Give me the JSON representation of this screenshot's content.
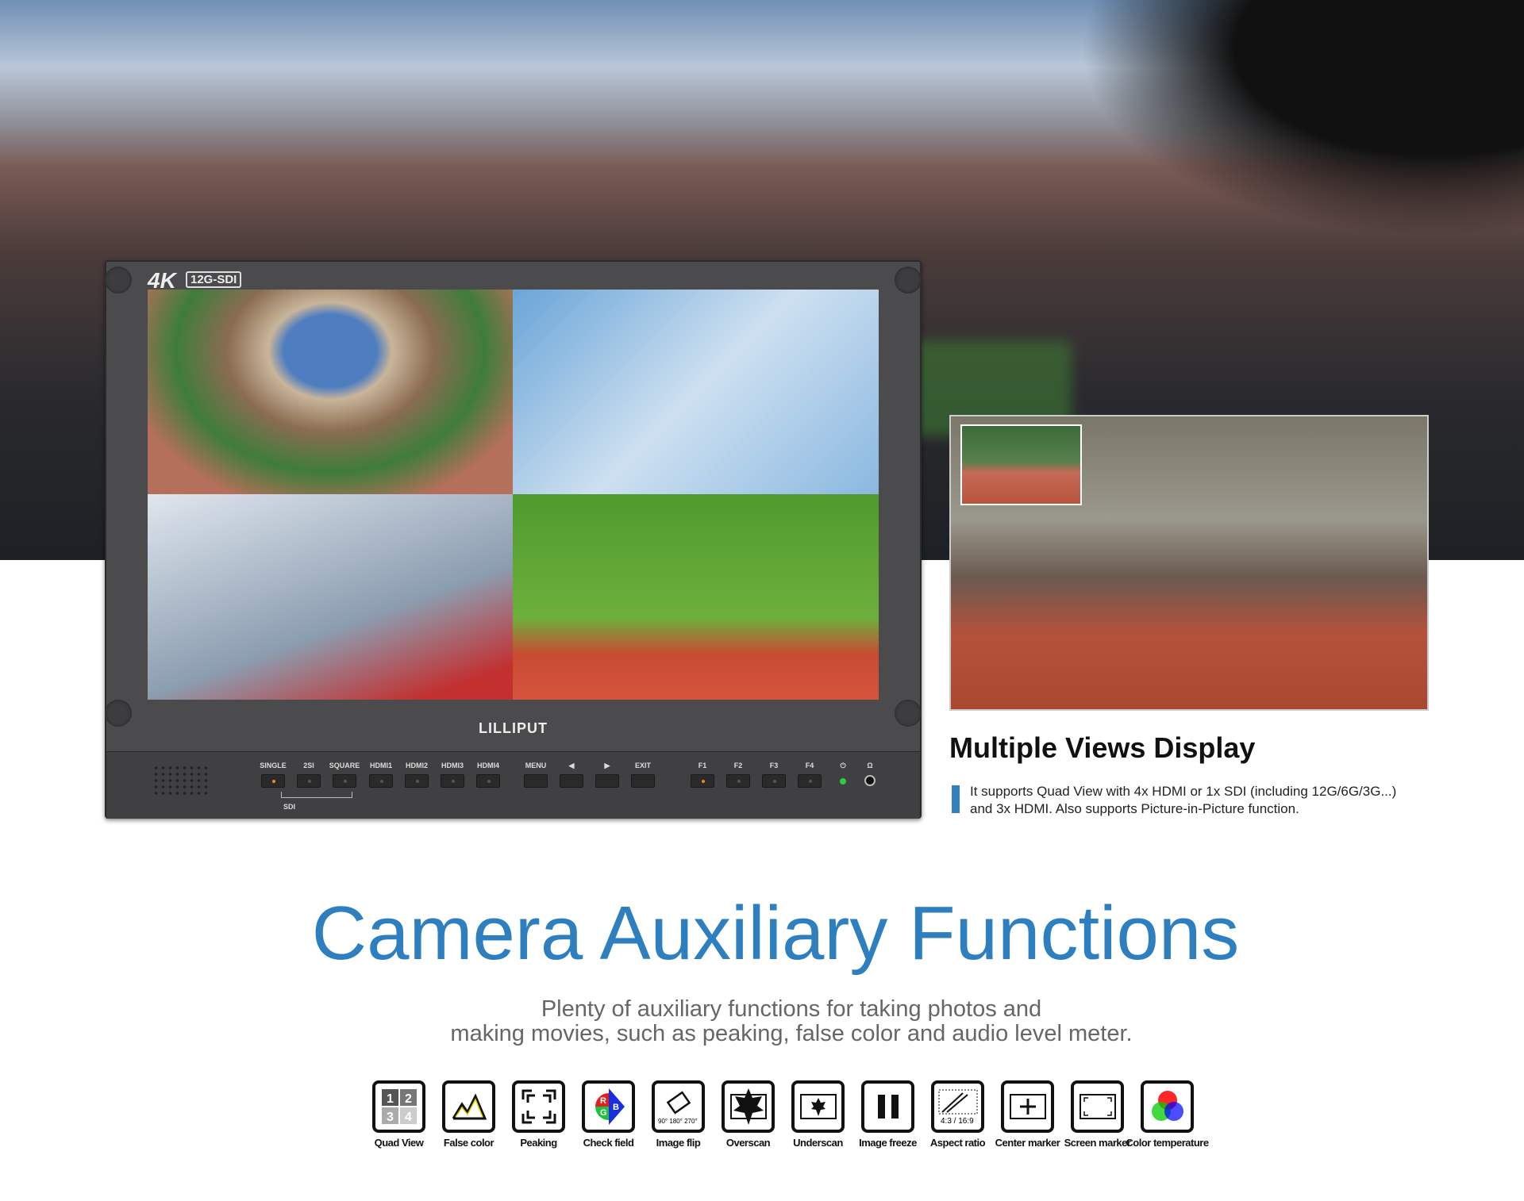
{
  "monitor": {
    "badge_4k": "4K",
    "badge_interface": "12G-SDI",
    "brand": "LILLIPUT",
    "buttons": [
      {
        "label": "SINGLE",
        "led": "on"
      },
      {
        "label": "2SI",
        "led": "off"
      },
      {
        "label": "SQUARE",
        "led": "off"
      },
      {
        "label": "HDMI1",
        "led": "off"
      },
      {
        "label": "HDMI2",
        "led": "off"
      },
      {
        "label": "HDMI3",
        "led": "off"
      },
      {
        "label": "HDMI4",
        "led": "off"
      },
      {
        "label": "MENU",
        "led": "none"
      },
      {
        "label": "◀",
        "led": "none"
      },
      {
        "label": "▶",
        "led": "none"
      },
      {
        "label": "EXIT",
        "led": "none"
      },
      {
        "label": "F1",
        "led": "on"
      },
      {
        "label": "F2",
        "led": "off"
      },
      {
        "label": "F3",
        "led": "off"
      },
      {
        "label": "F4",
        "led": "off"
      }
    ],
    "sdi_group_label": "SDI",
    "power_icon": "⏻",
    "headphone_icon": "Ω",
    "power_led_color": "#2ecc40"
  },
  "feature": {
    "title": "Multiple Views Display",
    "description_lines": [
      "It supports Quad View with 4x HDMI or 1x SDI (including 12G/6G/3G...)",
      "and 3x HDMI. Also supports Picture-in-Picture function."
    ]
  },
  "section": {
    "title": "Camera Auxiliary Functions",
    "subtitle_lines": [
      "Plenty of auxiliary functions for taking photos and",
      "making movies, such as peaking, false color and audio level meter."
    ]
  },
  "functions": [
    {
      "label": "Quad View",
      "icon": "quad-view"
    },
    {
      "label": "False color",
      "icon": "false-color"
    },
    {
      "label": "Peaking",
      "icon": "peaking"
    },
    {
      "label": "Check field",
      "icon": "check-field"
    },
    {
      "label": "Image flip",
      "icon": "image-flip"
    },
    {
      "label": "Overscan",
      "icon": "overscan"
    },
    {
      "label": "Underscan",
      "icon": "underscan"
    },
    {
      "label": "Image freeze",
      "icon": "image-freeze"
    },
    {
      "label": "Aspect ratio",
      "icon": "aspect-ratio"
    },
    {
      "label": "Center marker",
      "icon": "center-marker"
    },
    {
      "label": "Screen marker",
      "icon": "screen-marker"
    },
    {
      "label": "Color temperature",
      "icon": "color-temperature"
    }
  ],
  "icon_text": {
    "flip_angles": "90° 180° 270°",
    "aspect": "4:3 / 16:9",
    "quad": [
      "1",
      "2",
      "3",
      "4"
    ],
    "rgb": [
      "R",
      "G",
      "B"
    ]
  },
  "colors": {
    "accent": "#2e7fbf",
    "led_orange": "#f08a1c"
  }
}
